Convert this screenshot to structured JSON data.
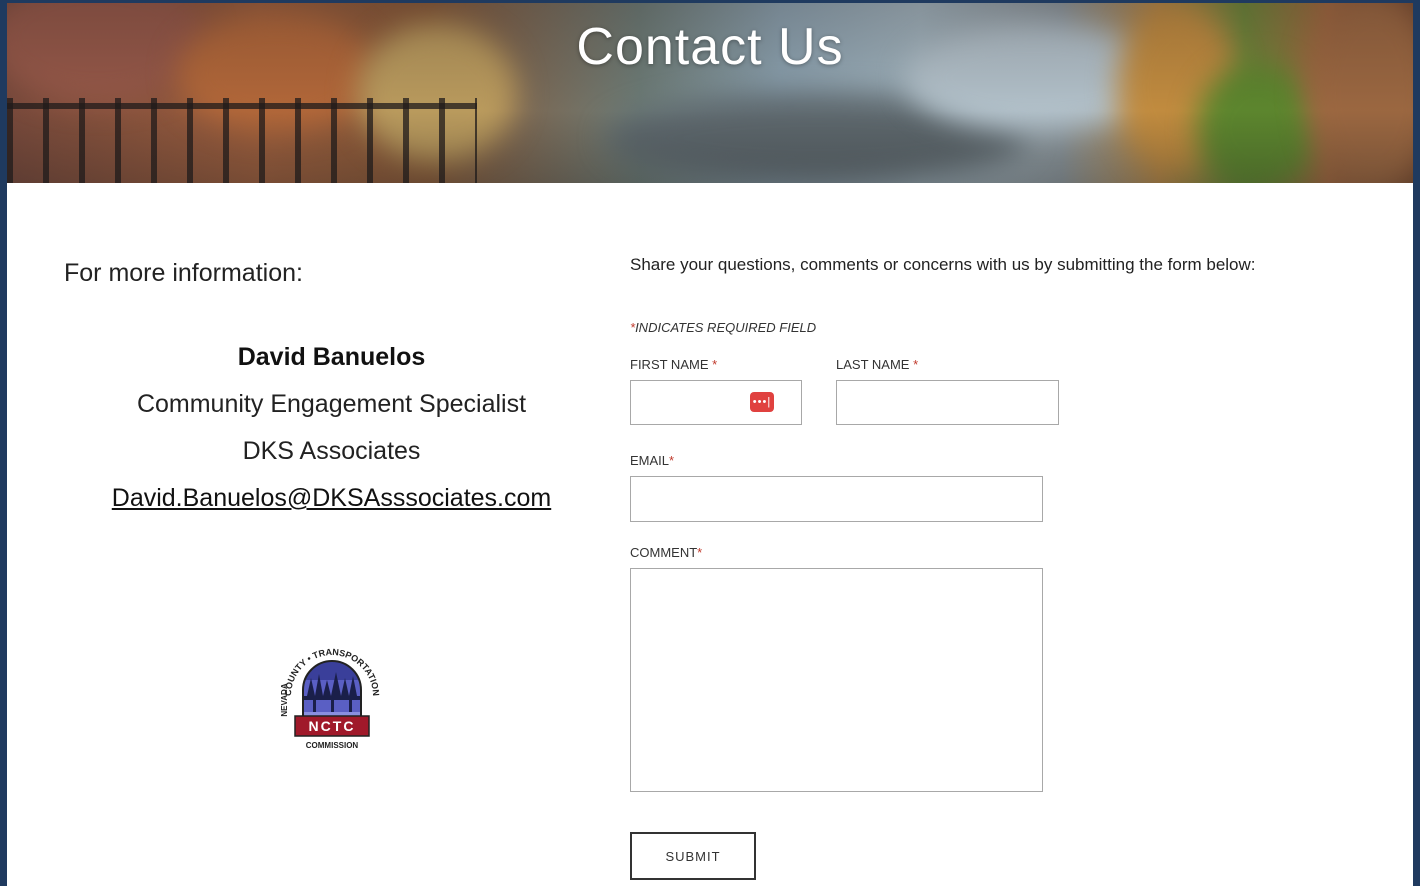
{
  "hero": {
    "title": "Contact Us"
  },
  "left": {
    "heading": "For more information:",
    "contact": {
      "name": "David Banuelos",
      "role": "Community Engagement Specialist",
      "company": "DKS Associates",
      "email": "David.Banuelos@DKSAsssociates.com"
    },
    "logo": {
      "top_text": "COUNTY • TRANSPORTATION",
      "left_text": "NEVADA",
      "badge": "NCTC",
      "bottom_text": "COMMISSION"
    }
  },
  "form": {
    "intro": "Share your questions, comments or concerns with us by submitting the form below:",
    "required_star": "*",
    "required_note": "INDICATES REQUIRED FIELD",
    "first_name_label": "FIRST NAME",
    "last_name_label": "LAST NAME",
    "email_label": "EMAIL",
    "comment_label": "COMMENT",
    "first_name_value": "",
    "last_name_value": "",
    "email_value": "",
    "comment_value": "",
    "password_manager_icon": "•••|",
    "submit_label": "SUBMIT"
  },
  "colors": {
    "outer_border": "#1f3a5f",
    "required_star": "#c0392b",
    "password_badge": "#e0413f",
    "logo_red": "#a0192a",
    "logo_blue": "#3a3f9a"
  },
  "icons": [
    "password-manager-icon",
    "nctc-logo"
  ]
}
